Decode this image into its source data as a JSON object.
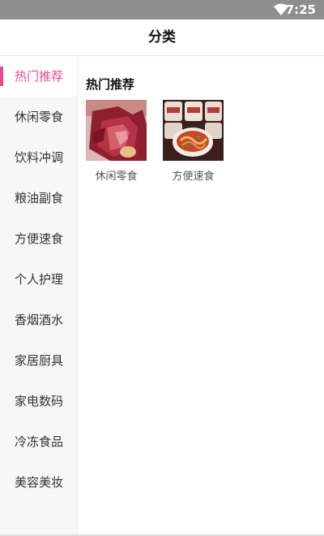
{
  "status_bar": {
    "time": "7:25"
  },
  "header": {
    "title": "分类"
  },
  "sidebar": {
    "items": [
      {
        "label": "热门推荐",
        "active": true
      },
      {
        "label": "休闲零食"
      },
      {
        "label": "饮料冲调"
      },
      {
        "label": "粮油副食"
      },
      {
        "label": "方便速食"
      },
      {
        "label": "个人护理"
      },
      {
        "label": "香烟酒水"
      },
      {
        "label": "家居厨具"
      },
      {
        "label": "家电数码"
      },
      {
        "label": "冷冻食品"
      },
      {
        "label": "美容美妆"
      }
    ]
  },
  "main": {
    "section_title": "热门推荐",
    "categories": [
      {
        "label": "休闲零食",
        "icon": "snack-image"
      },
      {
        "label": "方便速食",
        "icon": "instant-food-image"
      }
    ]
  },
  "colors": {
    "accent": "#e44b8d",
    "statusbar": "#8e8e8e"
  }
}
